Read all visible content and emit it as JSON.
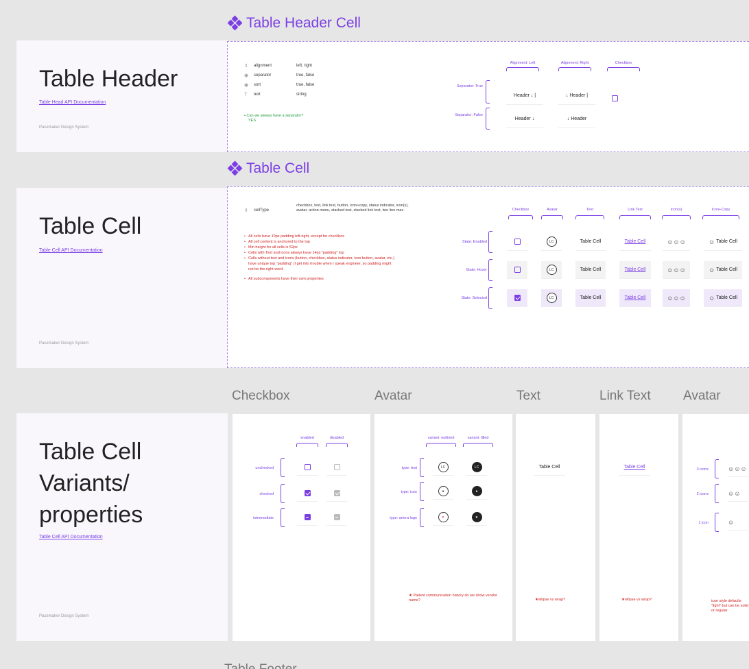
{
  "sections": {
    "header_cell_title": "Table Header Cell",
    "table_cell_title": "Table Cell",
    "footer_title": "Table Footer"
  },
  "table_header": {
    "title": "Table Header",
    "doc_link": "Table Head API Documentation",
    "footer": "Pacemaker Design System",
    "props": [
      {
        "icon": "⇕",
        "name": "alignment",
        "value": "left, right"
      },
      {
        "icon": "◉",
        "name": "separator",
        "value": "true, false"
      },
      {
        "icon": "◉",
        "name": "sort",
        "value": "true, false"
      },
      {
        "icon": "T",
        "name": "text",
        "value": "string"
      }
    ],
    "note_q": "Can we always have a separator?",
    "note_a": "YES",
    "columns": [
      "Alignment: Left",
      "Alignment: Right",
      "Checkbox"
    ],
    "rows": [
      {
        "label": "Separator: True",
        "left": "Header ↓  |",
        "right": "↓ Header  |"
      },
      {
        "label": "Separator: False",
        "left": "Header ↓",
        "right": "↓ Header"
      }
    ]
  },
  "table_cell": {
    "title": "Table Cell",
    "doc_link": "Table Cell API Documentation",
    "footer": "Pacemaker Design System",
    "prop_name": "cellType",
    "prop_value": "checkbox, text, link text, button, icon+copy, status indicator, icon(s), avatar, action menu, stacked text, stacked link text, two line max",
    "notes": [
      "All cells have 10px padding left-right, except for checkbox",
      "All cell content is anchored to the top",
      "Min height for all cells is 52px",
      "Cells with Text and icons always have 14px \"padding\" top",
      "Cells without text and icons (button, checkbox, status indicator, icon button, avatar, etc.) have unique top \"padding\" (I get into trouble when I speak engineer, so padding might not be the right word.",
      "All subcomponents have their own properties"
    ],
    "columns": [
      "Checkbox",
      "Avatar",
      "Text",
      "Link Text",
      "Icon(s)",
      "Icon+Copy"
    ],
    "states": [
      "State: Enabled",
      "State: Hover",
      "State: Selected"
    ],
    "avatar_initials": "LC",
    "cell_text": "Table Cell",
    "icons_text": "☺☺☺",
    "icon_copy_icon": "☺"
  },
  "variants": {
    "title": "Table Cell Variants/ properties",
    "doc_link": "Table Cell API Documentation",
    "footer": "Pacemaker Design System",
    "checkbox": {
      "heading": "Checkbox",
      "columns": [
        "enabled",
        "disabled"
      ],
      "rows": [
        "unchecked",
        "checked",
        "intermediate"
      ]
    },
    "avatar": {
      "heading": "Avatar",
      "columns": [
        "variant: outlined",
        "variant: filled"
      ],
      "rows": [
        "type: text",
        "type: icon",
        "type: artera logo"
      ],
      "initials": "LC",
      "note": "Patient communication history do we show vendor name?"
    },
    "text": {
      "heading": "Text",
      "sample": "Table Cell",
      "note": "ellipse vs wrap?"
    },
    "link_text": {
      "heading": "Link Text",
      "sample": "Table Cell",
      "note": "ellipse vs wrap?"
    },
    "icons": {
      "heading": "Avatar",
      "rows": [
        "3 icons",
        "2 icons",
        "1 icon"
      ],
      "glyphs": [
        "☺☺☺",
        "☺☺",
        "☺"
      ],
      "note": "icon style defaults \"light\" but can be solid or regular"
    }
  },
  "colors": {
    "accent": "#7b3fe4",
    "warning": "#d02020",
    "ok": "#1f9b3c"
  }
}
